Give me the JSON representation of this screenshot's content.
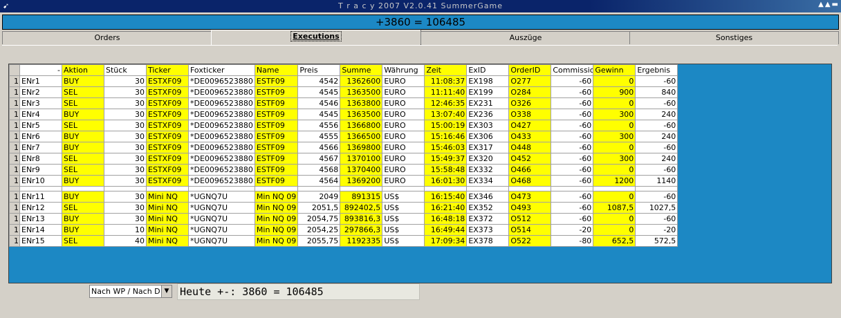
{
  "window": {
    "title": "T r a c y  2007 V2.0.41 SummerGame"
  },
  "top_status": "+3860 = 106485",
  "tabs": [
    {
      "label": "Orders"
    },
    {
      "label": "Executions"
    },
    {
      "label": "Auszüge"
    },
    {
      "label": "Sonstiges"
    }
  ],
  "table": {
    "headers": [
      "",
      "Aktion",
      "Stück",
      "Ticker",
      "Foxticker",
      "Name",
      "Preis",
      "Summe",
      "Währung",
      "Zeit",
      "ExID",
      "OrderID",
      "Commissions",
      "Gewinn",
      "Ergebnis"
    ],
    "rows": [
      [
        "1",
        "ENr1",
        "BUY",
        "30",
        "ESTXF09",
        "*DE0096523880",
        "ESTF09",
        "4542",
        "1362600",
        "EURO",
        "11:08:37",
        "EX198",
        "O277",
        "-60",
        "0",
        "-60"
      ],
      [
        "1",
        "ENr2",
        "SEL",
        "30",
        "ESTXF09",
        "*DE0096523880",
        "ESTF09",
        "4545",
        "1363500",
        "EURO",
        "11:11:40",
        "EX199",
        "O284",
        "-60",
        "900",
        "840"
      ],
      [
        "1",
        "ENr3",
        "SEL",
        "30",
        "ESTXF09",
        "*DE0096523880",
        "ESTF09",
        "4546",
        "1363800",
        "EURO",
        "12:46:35",
        "EX231",
        "O326",
        "-60",
        "0",
        "-60"
      ],
      [
        "1",
        "ENr4",
        "BUY",
        "30",
        "ESTXF09",
        "*DE0096523880",
        "ESTF09",
        "4545",
        "1363500",
        "EURO",
        "13:07:40",
        "EX236",
        "O338",
        "-60",
        "300",
        "240"
      ],
      [
        "1",
        "ENr5",
        "SEL",
        "30",
        "ESTXF09",
        "*DE0096523880",
        "ESTF09",
        "4556",
        "1366800",
        "EURO",
        "15:00:19",
        "EX303",
        "O427",
        "-60",
        "0",
        "-60"
      ],
      [
        "1",
        "ENr6",
        "BUY",
        "30",
        "ESTXF09",
        "*DE0096523880",
        "ESTF09",
        "4555",
        "1366500",
        "EURO",
        "15:16:46",
        "EX306",
        "O433",
        "-60",
        "300",
        "240"
      ],
      [
        "1",
        "ENr7",
        "BUY",
        "30",
        "ESTXF09",
        "*DE0096523880",
        "ESTF09",
        "4566",
        "1369800",
        "EURO",
        "15:46:03",
        "EX317",
        "O448",
        "-60",
        "0",
        "-60"
      ],
      [
        "1",
        "ENr8",
        "SEL",
        "30",
        "ESTXF09",
        "*DE0096523880",
        "ESTF09",
        "4567",
        "1370100",
        "EURO",
        "15:49:37",
        "EX320",
        "O452",
        "-60",
        "300",
        "240"
      ],
      [
        "1",
        "ENr9",
        "SEL",
        "30",
        "ESTXF09",
        "*DE0096523880",
        "ESTF09",
        "4568",
        "1370400",
        "EURO",
        "15:58:48",
        "EX332",
        "O466",
        "-60",
        "0",
        "-60"
      ],
      [
        "1",
        "ENr10",
        "BUY",
        "30",
        "ESTXF09",
        "*DE0096523880",
        "ESTF09",
        "4564",
        "1369200",
        "EURO",
        "16:01:30",
        "EX334",
        "O468",
        "-60",
        "1200",
        "1140"
      ],
      null,
      [
        "1",
        "ENr11",
        "BUY",
        "30",
        "Mini NQ",
        "*UGNQ7U",
        "Min NQ 09",
        "2049",
        "891315",
        "US$",
        "16:15:40",
        "EX346",
        "O473",
        "-60",
        "0",
        "-60"
      ],
      [
        "1",
        "ENr12",
        "SEL",
        "30",
        "Mini NQ",
        "*UGNQ7U",
        "Min NQ 09",
        "2051,5",
        "892402,5",
        "US$",
        "16:21:40",
        "EX352",
        "O493",
        "-60",
        "1087,5",
        "1027,5"
      ],
      [
        "1",
        "ENr13",
        "BUY",
        "30",
        "Mini NQ",
        "*UGNQ7U",
        "Min NQ 09",
        "2054,75",
        "893816,3",
        "US$",
        "16:48:18",
        "EX372",
        "O512",
        "-60",
        "0",
        "-60"
      ],
      [
        "1",
        "ENr14",
        "BUY",
        "10",
        "Mini NQ",
        "*UGNQ7U",
        "Min NQ 09",
        "2054,25",
        "297866,3",
        "US$",
        "16:49:44",
        "EX373",
        "O514",
        "-20",
        "0",
        "-20"
      ],
      [
        "1",
        "ENr15",
        "SEL",
        "40",
        "Mini NQ",
        "*UGNQ7U",
        "Min NQ 09",
        "2055,75",
        "1192335",
        "US$",
        "17:09:34",
        "EX378",
        "O522",
        "-80",
        "652,5",
        "572,5"
      ]
    ]
  },
  "bottom": {
    "sort_select": "Nach WP / Nach Da",
    "summary": "Heute +-: 3860 = 106485"
  }
}
